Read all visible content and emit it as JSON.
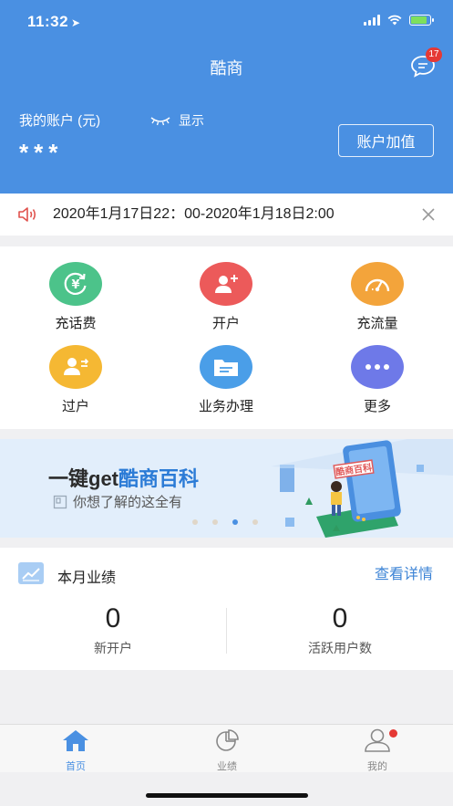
{
  "status_bar": {
    "time": "11:32"
  },
  "header": {
    "title": "酷商",
    "message_badge": "17",
    "account_label": "我的账户 (元)",
    "show_label": "显示",
    "account_value": "***",
    "recharge_label": "账户加值"
  },
  "notice": {
    "text": "2020年1月17日22：00-2020年1月18日2:00"
  },
  "grid": [
    {
      "label": "充话费",
      "icon": "yuan-recharge-icon",
      "color": "#4cc38a"
    },
    {
      "label": "开户",
      "icon": "add-user-icon",
      "color": "#ec5a5a"
    },
    {
      "label": "充流量",
      "icon": "gauge-icon",
      "color": "#f3a43b"
    },
    {
      "label": "过户",
      "icon": "transfer-user-icon",
      "color": "#f5b833"
    },
    {
      "label": "业务办理",
      "icon": "folder-icon",
      "color": "#4a9ee8"
    },
    {
      "label": "更多",
      "icon": "more-icon",
      "color": "#6e79e8"
    }
  ],
  "banner": {
    "title_prefix": "一键get",
    "title_highlight": "酷商百科",
    "subtitle": "你想了解的这全有",
    "sign_text": "酷商百科",
    "active_slide": 3,
    "slide_count": 4
  },
  "stats": {
    "title": "本月业绩",
    "link": "查看详情",
    "items": [
      {
        "value": "0",
        "label": "新开户"
      },
      {
        "value": "0",
        "label": "活跃用户数"
      }
    ]
  },
  "tabbar": [
    {
      "label": "首页",
      "icon": "home-icon",
      "active": true
    },
    {
      "label": "业绩",
      "icon": "pie-chart-icon",
      "active": false
    },
    {
      "label": "我的",
      "icon": "profile-icon",
      "active": false
    }
  ],
  "colors": {
    "brand": "#4a90e2",
    "link": "#3d84d6",
    "badge": "#e53935"
  }
}
